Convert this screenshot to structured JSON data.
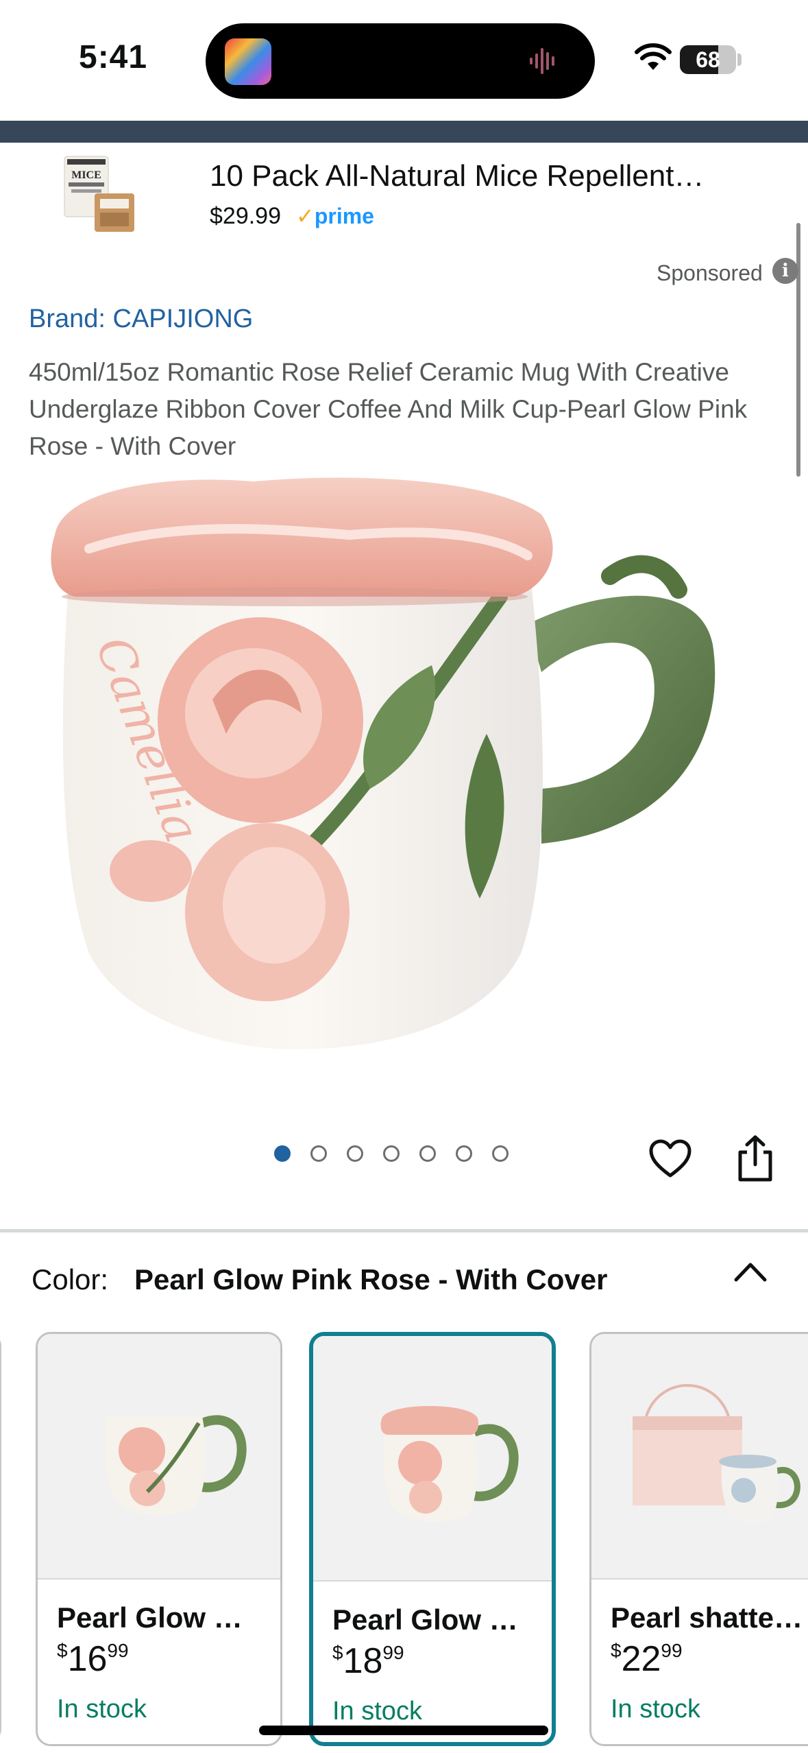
{
  "status_bar": {
    "time": "5:41",
    "battery": "68",
    "battery_level": 0.68
  },
  "sponsored_ad": {
    "title": "10 Pack All-Natural Mice Repellent…",
    "price": "$29.99",
    "prime_check": "✓",
    "prime_label": "prime",
    "thumb_text": "MICE"
  },
  "sponsored_label": "Sponsored",
  "product": {
    "brand": "Brand: CAPIJIONG",
    "title": "450ml/15oz Romantic Rose Relief Ceramic Mug With Creative Underglaze Ribbon Cover Coffee And Milk Cup-Pearl Glow Pink Rose - With Cover",
    "image_count": 7,
    "active_image": 1
  },
  "variation": {
    "label": "Color:",
    "selected": "Pearl Glow Pink Rose - With Cover",
    "options": [
      {
        "name": "Pearl Glow …",
        "price_symbol": "$",
        "price_whole": "16",
        "price_cents": "99",
        "stock": "In stock"
      },
      {
        "name": "Pearl Glow …",
        "price_symbol": "$",
        "price_whole": "18",
        "price_cents": "99",
        "stock": "In stock"
      },
      {
        "name": "Pearl shatte…",
        "price_symbol": "$",
        "price_whole": "22",
        "price_cents": "99",
        "stock": "In stock"
      }
    ]
  },
  "colors": {
    "link_blue": "#2162a1",
    "stock_green": "#067d62",
    "selected_border": "#117f90",
    "header_stripe": "#37475a"
  }
}
